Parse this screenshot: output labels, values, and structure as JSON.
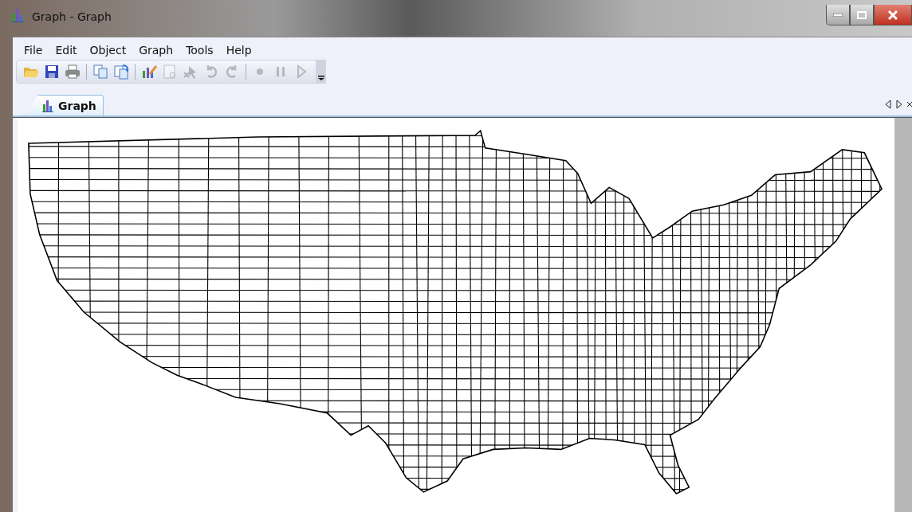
{
  "window": {
    "title": "Graph - Graph"
  },
  "menu": [
    "File",
    "Edit",
    "Object",
    "Graph",
    "Tools",
    "Help"
  ],
  "toolbar": [
    [
      {
        "disabled": false
      },
      {
        "disabled": false
      },
      {
        "disabled": false
      }
    ],
    [
      {
        "disabled": false
      },
      {
        "disabled": false
      }
    ],
    [
      {
        "disabled": false
      },
      {
        "disabled": true
      },
      {
        "disabled": true
      },
      {
        "disabled": true
      },
      {
        "disabled": true
      }
    ],
    [
      {
        "disabled": true
      },
      {
        "disabled": true
      },
      {
        "disabled": true
      }
    ]
  ],
  "tabs": [
    {
      "label": "Graph",
      "selected": true
    }
  ]
}
